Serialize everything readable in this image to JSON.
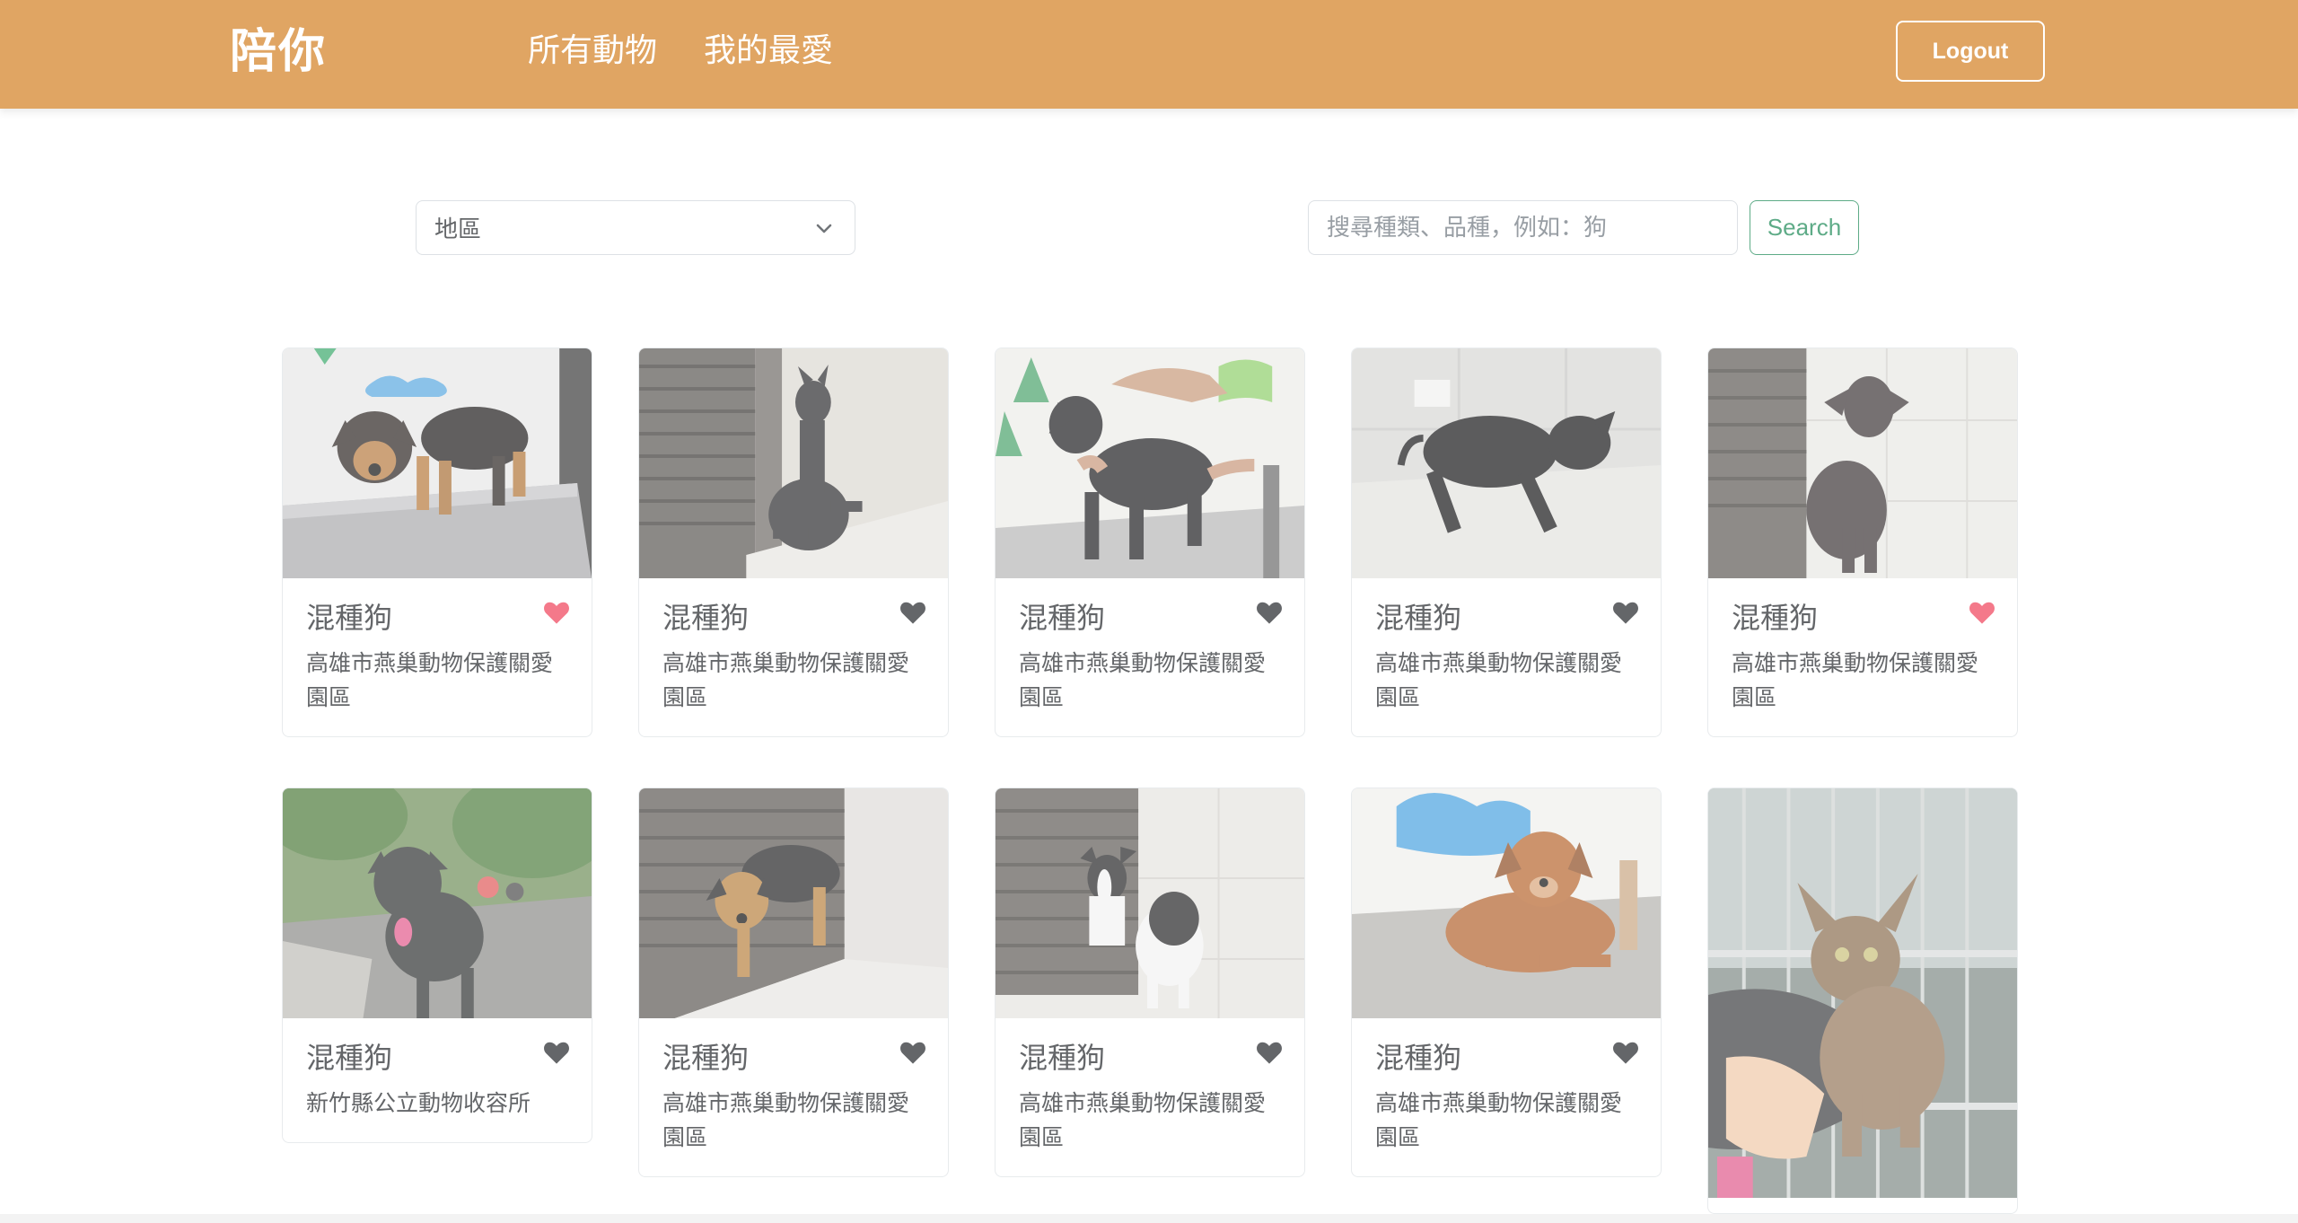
{
  "navbar": {
    "brand": "陪你",
    "links": {
      "all_animals": "所有動物",
      "favorites": "我的最愛"
    },
    "logout": "Logout",
    "color": "#e0a563"
  },
  "filters": {
    "region_selected": "地區",
    "search_placeholder": "搜尋種類、品種，例如：狗",
    "search_button": "Search",
    "search_color": "#198754"
  },
  "cards": [
    {
      "title": "混種狗",
      "location": "高雄市燕巢動物保護關愛園區",
      "favorited": true
    },
    {
      "title": "混種狗",
      "location": "高雄市燕巢動物保護關愛園區",
      "favorited": false
    },
    {
      "title": "混種狗",
      "location": "高雄市燕巢動物保護關愛園區",
      "favorited": false
    },
    {
      "title": "混種狗",
      "location": "高雄市燕巢動物保護關愛園區",
      "favorited": false
    },
    {
      "title": "混種狗",
      "location": "高雄市燕巢動物保護關愛園區",
      "favorited": true
    },
    {
      "title": "混種狗",
      "location": "新竹縣公立動物收容所",
      "favorited": false
    },
    {
      "title": "混種狗",
      "location": "高雄市燕巢動物保護關愛園區",
      "favorited": false
    },
    {
      "title": "混種狗",
      "location": "高雄市燕巢動物保護關愛園區",
      "favorited": false
    },
    {
      "title": "混種狗",
      "location": "高雄市燕巢動物保護關愛園區",
      "favorited": false
    }
  ],
  "heart_colors": {
    "favorited": "#ef4058",
    "default": "#212529"
  }
}
